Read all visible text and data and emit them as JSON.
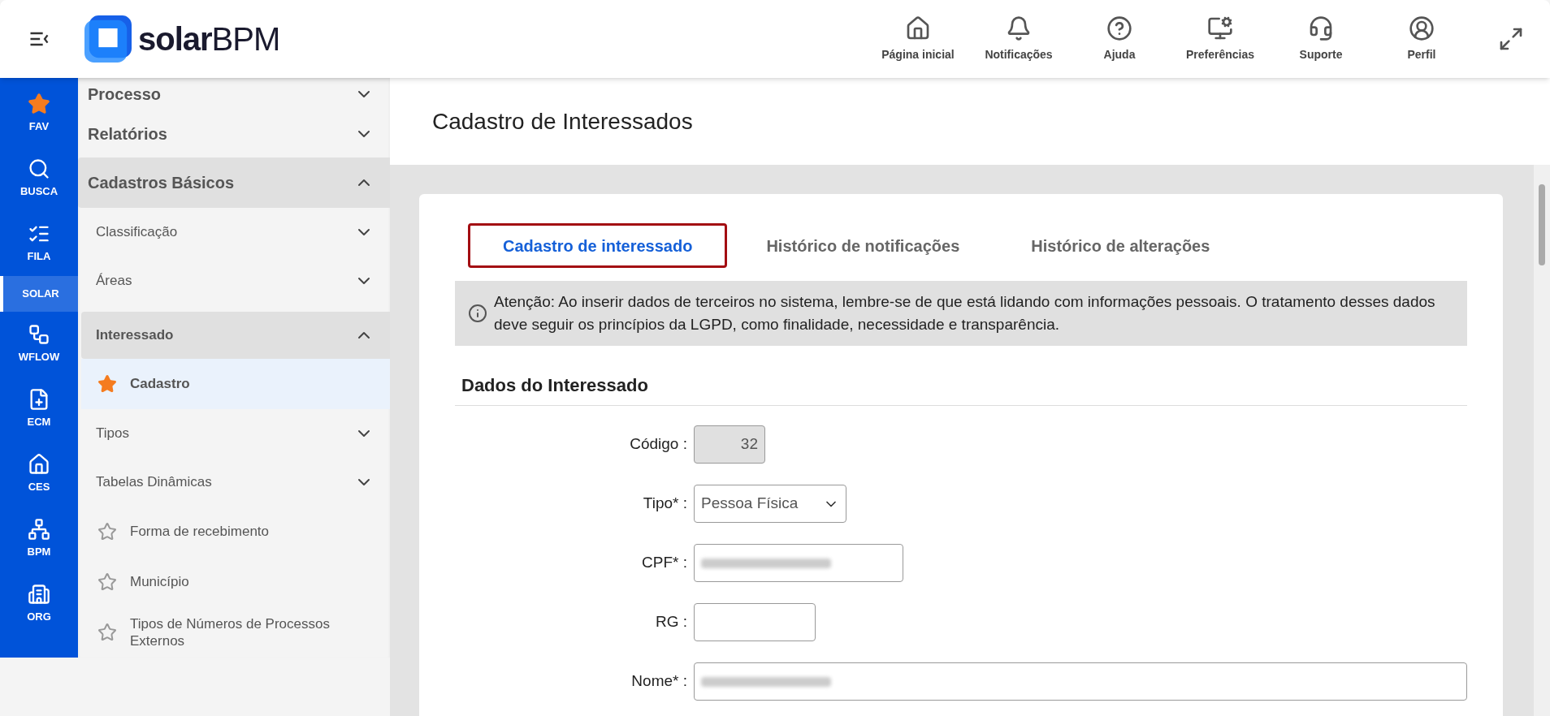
{
  "header": {
    "logo": {
      "bold": "solar",
      "light": "BPM"
    },
    "nav": [
      {
        "label": "Página inicial"
      },
      {
        "label": "Notificações"
      },
      {
        "label": "Ajuda"
      },
      {
        "label": "Preferências"
      },
      {
        "label": "Suporte"
      },
      {
        "label": "Perfil"
      }
    ]
  },
  "rail": [
    {
      "label": "FAV",
      "selected": false
    },
    {
      "label": "BUSCA",
      "selected": false
    },
    {
      "label": "FILA",
      "selected": false
    },
    {
      "label": "SOLAR",
      "selected": true
    },
    {
      "label": "WFLOW",
      "selected": false
    },
    {
      "label": "ECM",
      "selected": false
    },
    {
      "label": "CES",
      "selected": false
    },
    {
      "label": "BPM",
      "selected": false
    },
    {
      "label": "ORG",
      "selected": false
    }
  ],
  "sidebar": {
    "items": [
      {
        "kind": "section",
        "label": "Processo",
        "expanded": false
      },
      {
        "kind": "section",
        "label": "Relatórios",
        "expanded": false
      },
      {
        "kind": "section",
        "label": "Cadastros Básicos",
        "expanded": true
      },
      {
        "kind": "group",
        "label": "Classificação",
        "expanded": false
      },
      {
        "kind": "group",
        "label": "Áreas",
        "expanded": false
      },
      {
        "kind": "group",
        "label": "Interessado",
        "expanded": true
      },
      {
        "kind": "link",
        "label": "Cadastro",
        "favorite": true,
        "selected": true
      },
      {
        "kind": "group",
        "label": "Tipos",
        "expanded": false
      },
      {
        "kind": "group",
        "label": "Tabelas Dinâmicas",
        "expanded": false
      },
      {
        "kind": "link",
        "label": "Forma de recebimento",
        "favorite": false,
        "selected": false
      },
      {
        "kind": "link",
        "label": "Município",
        "favorite": false,
        "selected": false
      },
      {
        "kind": "link",
        "label": "Tipos de Números de Processos Externos",
        "favorite": false,
        "selected": false
      }
    ]
  },
  "page": {
    "title": "Cadastro de Interessados",
    "tabs": [
      {
        "label": "Cadastro de interessado",
        "selected": true
      },
      {
        "label": "Histórico de notificações",
        "selected": false
      },
      {
        "label": "Histórico de alterações",
        "selected": false
      }
    ],
    "notice": "Atenção: Ao inserir dados de terceiros no sistema, lembre-se de que está lidando com informações pessoais. O tratamento desses dados deve seguir os princípios da LGPD, como finalidade, necessidade e transparência.",
    "section_title": "Dados do Interessado",
    "fields": [
      {
        "kind": "readonly",
        "label": "Código :",
        "value": "32"
      },
      {
        "kind": "select",
        "label": "Tipo* :",
        "value": "Pessoa Física"
      },
      {
        "kind": "blurred",
        "label": "CPF* :"
      },
      {
        "kind": "text",
        "label": "RG :"
      },
      {
        "kind": "blurred",
        "label": "Nome* :"
      }
    ]
  }
}
